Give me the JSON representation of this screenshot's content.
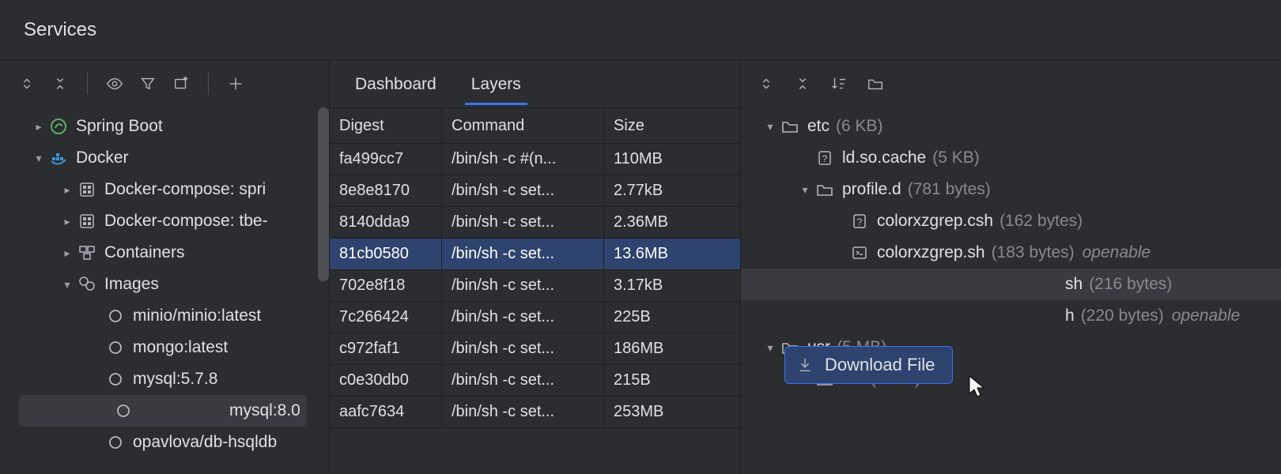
{
  "header": {
    "title": "Services"
  },
  "tree": {
    "items": [
      {
        "label": "Spring Boot",
        "indent": 0,
        "chev": "right",
        "icon": "spring"
      },
      {
        "label": "Docker",
        "indent": 0,
        "chev": "down",
        "icon": "docker"
      },
      {
        "label": "Docker-compose: spri",
        "indent": 1,
        "chev": "right",
        "icon": "compose"
      },
      {
        "label": "Docker-compose: tbe-",
        "indent": 1,
        "chev": "right",
        "icon": "compose"
      },
      {
        "label": "Containers",
        "indent": 1,
        "chev": "right",
        "icon": "containers"
      },
      {
        "label": "Images",
        "indent": 1,
        "chev": "down",
        "icon": "images"
      },
      {
        "label": "minio/minio:latest",
        "indent": 2,
        "chev": "",
        "icon": "image"
      },
      {
        "label": "mongo:latest",
        "indent": 2,
        "chev": "",
        "icon": "image"
      },
      {
        "label": "mysql:5.7.8",
        "indent": 2,
        "chev": "",
        "icon": "image"
      },
      {
        "label": "mysql:8.0",
        "indent": 2,
        "chev": "",
        "icon": "image",
        "hovered": true
      },
      {
        "label": "opavlova/db-hsqldb",
        "indent": 2,
        "chev": "",
        "icon": "image"
      }
    ]
  },
  "tabs": [
    {
      "label": "Dashboard",
      "active": false
    },
    {
      "label": "Layers",
      "active": true
    }
  ],
  "layers": {
    "columns": [
      "Digest",
      "Command",
      "Size"
    ],
    "rows": [
      {
        "digest": "fa499cc7",
        "cmd": "/bin/sh -c #(n...",
        "size": "110MB"
      },
      {
        "digest": "8e8e8170",
        "cmd": "/bin/sh -c set...",
        "size": "2.77kB"
      },
      {
        "digest": "8140dda9",
        "cmd": "/bin/sh -c set...",
        "size": "2.36MB"
      },
      {
        "digest": "81cb0580",
        "cmd": "/bin/sh -c set...",
        "size": "13.6MB",
        "selected": true
      },
      {
        "digest": "702e8f18",
        "cmd": "/bin/sh -c set...",
        "size": "3.17kB"
      },
      {
        "digest": "7c266424",
        "cmd": "/bin/sh -c set...",
        "size": "225B"
      },
      {
        "digest": "c972faf1",
        "cmd": "/bin/sh -c set...",
        "size": "186MB"
      },
      {
        "digest": "c0e30db0",
        "cmd": "/bin/sh -c set...",
        "size": "215B"
      },
      {
        "digest": "aafc7634",
        "cmd": "/bin/sh -c set...",
        "size": "253MB"
      }
    ]
  },
  "files": {
    "items": [
      {
        "label": "etc",
        "size": "(6 KB)",
        "indent": 0,
        "chev": "down",
        "icon": "folder"
      },
      {
        "label": "ld.so.cache",
        "size": "(5 KB)",
        "indent": 1,
        "chev": "",
        "icon": "unknown"
      },
      {
        "label": "profile.d",
        "size": "(781 bytes)",
        "indent": 1,
        "chev": "down",
        "icon": "folder"
      },
      {
        "label": "colorxzgrep.csh",
        "size": "(162 bytes)",
        "indent": 2,
        "chev": "",
        "icon": "unknown"
      },
      {
        "label": "colorxzgrep.sh",
        "size": "(183 bytes)",
        "indent": 2,
        "chev": "",
        "icon": "shell",
        "openable": "openable"
      },
      {
        "label": "sh",
        "size": "(216 bytes)",
        "indent": 2,
        "chev": "",
        "icon": "",
        "highlight": true,
        "pad": true
      },
      {
        "label": "h",
        "size": "(220 bytes)",
        "indent": 2,
        "chev": "",
        "icon": "",
        "openable": "openable",
        "pad": true
      },
      {
        "label": "usr",
        "size": "(5 MB)",
        "indent": 0,
        "chev": "down",
        "icon": "folder"
      },
      {
        "label": "bin",
        "size": "(2 MB)",
        "indent": 1,
        "chev": "down",
        "icon": "folder"
      }
    ]
  },
  "popup": {
    "label": "Download File"
  }
}
